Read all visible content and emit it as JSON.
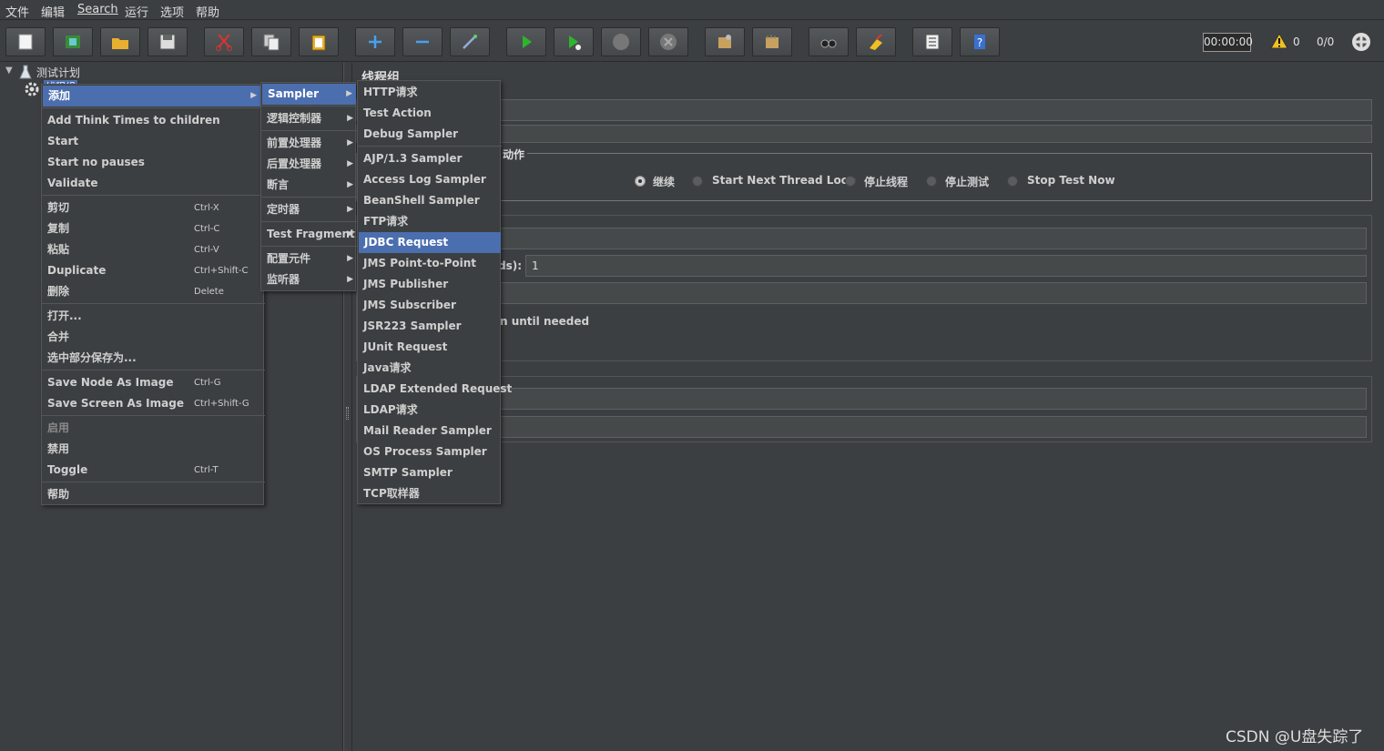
{
  "menubar": {
    "items": [
      "文件",
      "编辑",
      "Search",
      "运行",
      "选项",
      "帮助"
    ]
  },
  "toolbar": {
    "timer": "00:00:00",
    "warn_count": "0",
    "thread_ratio": "0/0"
  },
  "tree": {
    "root": "测试计划",
    "child": "线程组"
  },
  "right": {
    "title": "线程组",
    "action_label": "动作",
    "radios": [
      "继续",
      "Start Next Thread Loop",
      "停止线程",
      "停止测试",
      "Stop Test Now"
    ],
    "ramp_label": "ds):",
    "ramp_value": "1",
    "delay_text": "n until needed"
  },
  "context_menu": {
    "items": [
      {
        "label": "添加",
        "shortcut": "",
        "sub": true
      },
      {
        "label": "Add Think Times to children",
        "shortcut": ""
      },
      {
        "label": "Start",
        "shortcut": ""
      },
      {
        "label": "Start no pauses",
        "shortcut": ""
      },
      {
        "label": "Validate",
        "shortcut": ""
      },
      {
        "label": "剪切",
        "shortcut": "Ctrl-X"
      },
      {
        "label": "复制",
        "shortcut": "Ctrl-C"
      },
      {
        "label": "粘贴",
        "shortcut": "Ctrl-V"
      },
      {
        "label": "Duplicate",
        "shortcut": "Ctrl+Shift-C"
      },
      {
        "label": "删除",
        "shortcut": "Delete"
      },
      {
        "label": "打开...",
        "shortcut": ""
      },
      {
        "label": "合并",
        "shortcut": ""
      },
      {
        "label": "选中部分保存为...",
        "shortcut": ""
      },
      {
        "label": "Save Node As Image",
        "shortcut": "Ctrl-G"
      },
      {
        "label": "Save Screen As Image",
        "shortcut": "Ctrl+Shift-G"
      },
      {
        "label": "启用",
        "shortcut": ""
      },
      {
        "label": "禁用",
        "shortcut": ""
      },
      {
        "label": "Toggle",
        "shortcut": "Ctrl-T"
      },
      {
        "label": "帮助",
        "shortcut": ""
      }
    ]
  },
  "add_menu": {
    "items": [
      "Sampler",
      "逻辑控制器",
      "前置处理器",
      "后置处理器",
      "断言",
      "定时器",
      "Test Fragment",
      "配置元件",
      "监听器"
    ]
  },
  "sampler_menu": {
    "items": [
      "HTTP请求",
      "Test Action",
      "Debug Sampler",
      "AJP/1.3 Sampler",
      "Access Log Sampler",
      "BeanShell Sampler",
      "FTP请求",
      "JDBC Request",
      "JMS Point-to-Point",
      "JMS Publisher",
      "JMS Subscriber",
      "JSR223 Sampler",
      "JUnit Request",
      "Java请求",
      "LDAP Extended Request",
      "LDAP请求",
      "Mail Reader Sampler",
      "OS Process Sampler",
      "SMTP Sampler",
      "TCP取样器"
    ]
  },
  "watermark": "CSDN @U盘失踪了"
}
